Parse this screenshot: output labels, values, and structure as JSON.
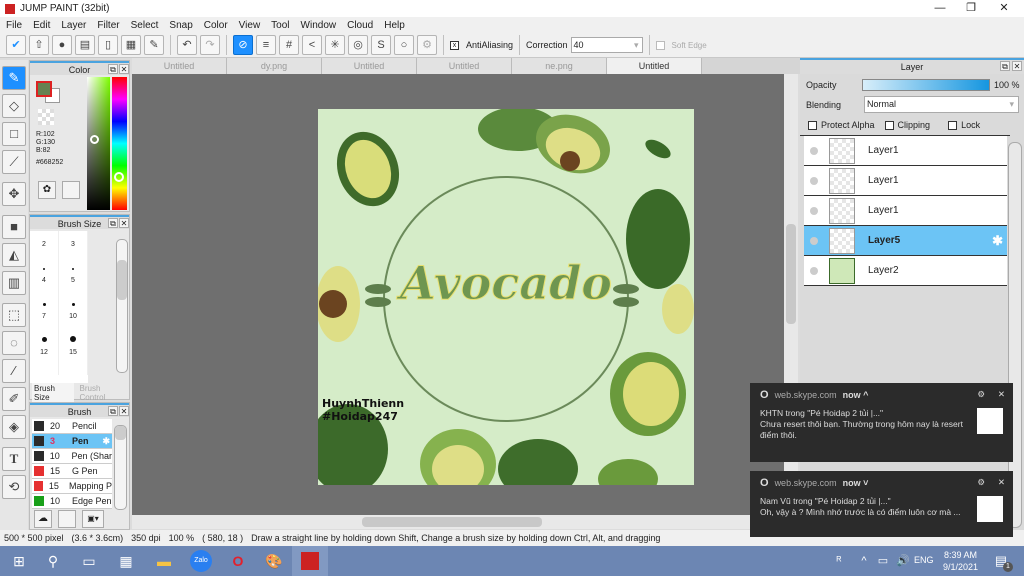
{
  "window": {
    "title": "JUMP PAINT (32bit)",
    "minimize": "—",
    "maximize": "❐",
    "close": "✕"
  },
  "menu": [
    "File",
    "Edit",
    "Layer",
    "Filter",
    "Select",
    "Snap",
    "Color",
    "View",
    "Tool",
    "Window",
    "Cloud",
    "Help"
  ],
  "toolbar": {
    "antialiasing_label": "AntiAliasing",
    "correction_label": "Correction",
    "correction_value": "40",
    "soft_edge_label": "Soft Edge"
  },
  "tabs": [
    "Untitled",
    "dy.png",
    "Untitled",
    "Untitled",
    "ne.png",
    "Untitled"
  ],
  "color_panel": {
    "title": "Color",
    "r": "R:102",
    "g": "G:130",
    "b": "B:82",
    "hex": "#668252",
    "primary_color": "#668252"
  },
  "brush_size_panel": {
    "title": "Brush Size",
    "sizes": [
      "2",
      "3",
      "4",
      "5",
      "7",
      "10",
      "12",
      "15"
    ],
    "tab_size": "Brush Size",
    "tab_control": "Brush Control"
  },
  "brush_panel": {
    "title": "Brush",
    "items": [
      {
        "size": "20",
        "name": "Pencil",
        "color": "#2a2a2a"
      },
      {
        "size": "3",
        "name": "Pen",
        "color": "#2a2a2a",
        "selected": true
      },
      {
        "size": "10",
        "name": "Pen (Shar",
        "color": "#2a2a2a"
      },
      {
        "size": "15",
        "name": "G Pen",
        "color": "#e53030"
      },
      {
        "size": "15",
        "name": "Mapping P",
        "color": "#e53030"
      },
      {
        "size": "10",
        "name": "Edge Pen",
        "color": "#19a019"
      }
    ]
  },
  "canvas": {
    "title_text": "Avocado",
    "watermark1": "HuynhThienn",
    "watermark2": "#Hoidap247",
    "background": "#d5ecc8"
  },
  "layer_panel": {
    "title": "Layer",
    "opacity_label": "Opacity",
    "opacity_value": "100 %",
    "opacity": 100,
    "blending_label": "Blending",
    "blending_value": "Normal",
    "protect_alpha": "Protect Alpha",
    "clipping": "Clipping",
    "lock": "Lock",
    "layers": [
      {
        "name": "Layer1"
      },
      {
        "name": "Layer1"
      },
      {
        "name": "Layer1"
      },
      {
        "name": "Layer5",
        "selected": true
      },
      {
        "name": "Layer2"
      }
    ]
  },
  "status": {
    "size": "500 * 500 pixel",
    "cm": "(3.6 * 3.6cm)",
    "dpi": "350 dpi",
    "zoom": "100 %",
    "coords": "( 580, 18 )",
    "hint": "Draw a straight line by holding down Shift, Change a brush size by holding down Ctrl, Alt, and dragging"
  },
  "notifications": [
    {
      "source": "web.skype.com",
      "time": "now ^",
      "title": "KHTN trong \"Pé Hoidap 2 tủi |...\"",
      "body": "Chưa resert thôi bạn. Thường trong hôm nay là resert điểm thôi."
    },
    {
      "source": "web.skype.com",
      "time": "now ˅",
      "title": "Nam Vũ trong \"Pé Hoidap 2 tủi |...\"",
      "body": "Oh, vậy à ? Mình nhớ trước là có điểm luôn cơ mà ..."
    }
  ],
  "taskbar": {
    "lang": "ENG",
    "time": "8:39 AM",
    "date": "9/1/2021",
    "notif_count": "1"
  }
}
